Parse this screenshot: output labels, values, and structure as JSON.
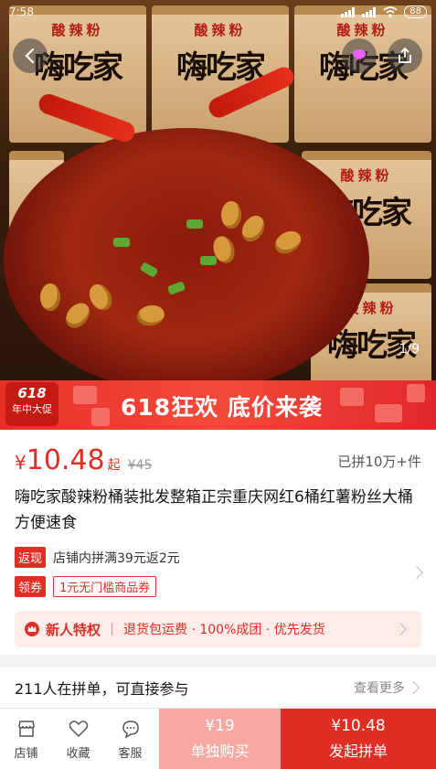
{
  "status_bar": {
    "time": "7:58",
    "battery": "88"
  },
  "hero": {
    "cup_top_text": "酸辣粉",
    "cup_brand_text": "嗨吃家",
    "counter": "1/9"
  },
  "banner": {
    "badge_main": "618",
    "badge_sub": "年中大促",
    "text": "618狂欢 底价来袭"
  },
  "price": {
    "currency": "¥",
    "value": "10.48",
    "suffix": "起",
    "original": "¥45",
    "sold": "已拼10万+件"
  },
  "product": {
    "title": "嗨吃家酸辣粉桶装批发整箱正宗重庆网红6桶红薯粉丝大桶方便速食"
  },
  "promos": {
    "cashback_tag": "返现",
    "cashback_text": "店铺内拼满39元返2元",
    "coupon_tag": "领券",
    "coupon_text": "1元无门槛商品券"
  },
  "new_user": {
    "label": "新人特权",
    "text": "退货包运费 · 100%成团 · 优先发货"
  },
  "group": {
    "text": "211人在拼单，可直接参与",
    "more": "查看更多"
  },
  "bottom_bar": {
    "shop": "店铺",
    "favorite": "收藏",
    "service": "客服",
    "single_price": "¥19",
    "single_label": "单独购买",
    "group_price": "¥10.48",
    "group_label": "发起拼单"
  },
  "colors": {
    "accent": "#e02e24",
    "accent_light": "#f6a8a3"
  }
}
